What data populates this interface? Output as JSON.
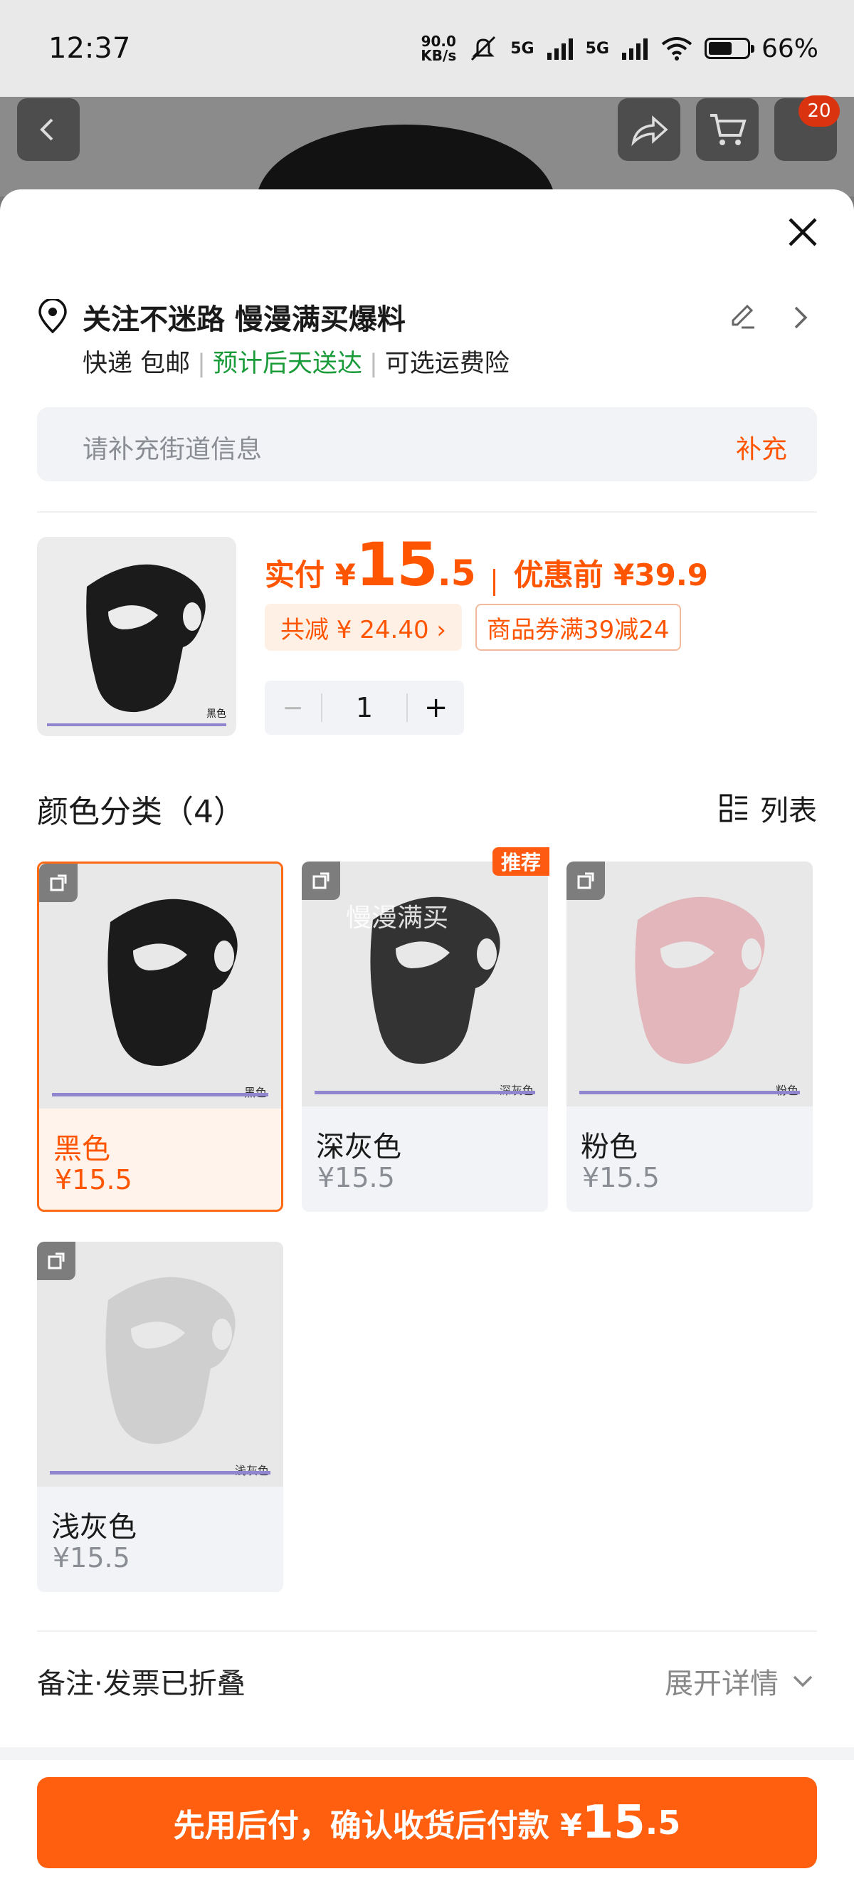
{
  "status_bar": {
    "time": "12:37",
    "netspeed": "90.0\nKB/s",
    "network": "5G",
    "battery": "66%",
    "battery_level": 0.66
  },
  "top_nav": {
    "cart_badge": "20"
  },
  "address": {
    "title": "关注不迷路 慢漫满买爆料",
    "shipping": "快递 包邮",
    "eta": "预计后天送达",
    "insurance": "可选运费险"
  },
  "street": {
    "placeholder": "请补充街道信息",
    "action": "补充"
  },
  "product": {
    "thumb_tag": "黑色",
    "pay_prefix": "实付 ¥",
    "pay_int": "15",
    "pay_dec": ".5",
    "orig_price": "优惠前 ¥39.9",
    "discount": "共减 ¥ 24.40 ›",
    "coupon": "商品券满39减24",
    "quantity": "1",
    "minus": "−",
    "plus": "+"
  },
  "variants": {
    "title": "颜色分类（4）",
    "list_label": "列表",
    "recommend_badge": "推荐",
    "watermark": "慢漫满买",
    "items": [
      {
        "name": "黑色",
        "price": "¥15.5",
        "tag": "黑色",
        "color": "#1b1b1b"
      },
      {
        "name": "深灰色",
        "price": "¥15.5",
        "tag": "深灰色",
        "color": "#333333"
      },
      {
        "name": "粉色",
        "price": "¥15.5",
        "tag": "粉色",
        "color": "#e2b6bb"
      },
      {
        "name": "浅灰色",
        "price": "¥15.5",
        "tag": "浅灰色",
        "color": "#cfcfcf"
      }
    ]
  },
  "remark": {
    "label": "备注·发票已折叠",
    "expand": "展开详情"
  },
  "pay_button": {
    "text": "先用后付，确认收货后付款 ¥",
    "int": "15",
    "dec": ".5"
  },
  "colors": {
    "accent": "#ff5500",
    "green": "#1a9b3a"
  }
}
